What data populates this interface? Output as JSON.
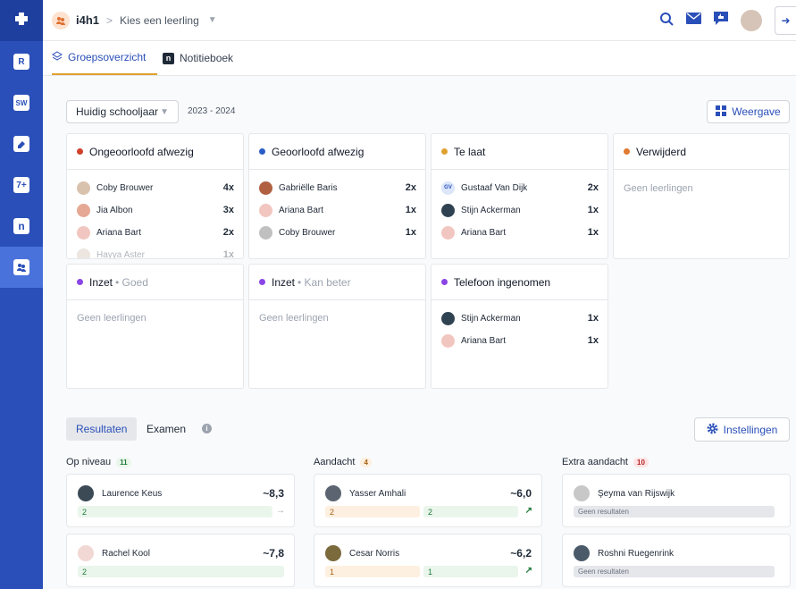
{
  "topbar": {
    "group_name": "i4h1",
    "separator": ">",
    "student_picker": "Kies een leerling"
  },
  "sidebar": {
    "items": [
      {
        "label": "R"
      },
      {
        "label": "SW"
      },
      {
        "label": ""
      },
      {
        "label": "7+"
      },
      {
        "label": "n"
      },
      {
        "label": ""
      }
    ]
  },
  "tabs": [
    {
      "label": "Groepsoverzicht",
      "active": true
    },
    {
      "label": "Notitieboek",
      "active": false
    }
  ],
  "toolbar": {
    "year_select": "Huidig schooljaar",
    "year_range": "2023 - 2024",
    "view_button": "Weergave"
  },
  "cards": [
    {
      "title": "Ongeoorloofd afwezig",
      "subtitle": "",
      "color": "#d0402a",
      "rows": [
        {
          "name": "Coby Brouwer",
          "count": "4x"
        },
        {
          "name": "Jia Albon",
          "count": "3x"
        },
        {
          "name": "Ariana Bart",
          "count": "2x"
        },
        {
          "name": "Hayya Aster",
          "count": "1x"
        }
      ]
    },
    {
      "title": "Geoorloofd afwezig",
      "subtitle": "",
      "color": "#2a5cc8",
      "rows": [
        {
          "name": "Gabriëlle Baris",
          "count": "2x"
        },
        {
          "name": "Ariana Bart",
          "count": "1x"
        },
        {
          "name": "Coby Brouwer",
          "count": "1x"
        }
      ]
    },
    {
      "title": "Te laat",
      "subtitle": "",
      "color": "#e0a030",
      "rows": [
        {
          "name": "Gustaaf Van Dijk",
          "count": "2x",
          "initials": "GV"
        },
        {
          "name": "Stijn Ackerman",
          "count": "1x"
        },
        {
          "name": "Ariana Bart",
          "count": "1x"
        }
      ]
    },
    {
      "title": "Verwijderd",
      "subtitle": "",
      "color": "#e07a30",
      "empty": "Geen leerlingen"
    },
    {
      "title": "Inzet",
      "subtitle": "• Goed",
      "color": "#8b45e6",
      "empty": "Geen leerlingen"
    },
    {
      "title": "Inzet",
      "subtitle": "• Kan beter",
      "color": "#8b45e6",
      "empty": "Geen leerlingen"
    },
    {
      "title": "Telefoon ingenomen",
      "subtitle": "",
      "color": "#8b45e6",
      "rows": [
        {
          "name": "Stijn Ackerman",
          "count": "1x"
        },
        {
          "name": "Ariana Bart",
          "count": "1x"
        }
      ]
    }
  ],
  "results": {
    "tabs": [
      "Resultaten",
      "Examen"
    ],
    "settings_button": "Instellingen",
    "columns": [
      {
        "title": "Op niveau",
        "count": "11",
        "students": [
          {
            "name": "Laurence Keus",
            "score": "~8,3",
            "bars": [
              "2"
            ],
            "trend": "→"
          },
          {
            "name": "Rachel Kool",
            "score": "~7,8",
            "bars": [
              "2"
            ],
            "trend": ""
          }
        ]
      },
      {
        "title": "Aandacht",
        "count": "4",
        "students": [
          {
            "name": "Yasser Amhali",
            "score": "~6,0",
            "bars": [
              "2",
              "2"
            ],
            "trend": "↗"
          },
          {
            "name": "Cesar Norris",
            "score": "~6,2",
            "bars": [
              "1",
              "1"
            ],
            "trend": "↗"
          }
        ]
      },
      {
        "title": "Extra aandacht",
        "count": "10",
        "students": [
          {
            "name": "Şeyma van Rijswijk",
            "score": "",
            "bars": [
              "Geen resultaten"
            ],
            "trend": ""
          },
          {
            "name": "Roshni Ruegenrink",
            "score": "",
            "bars": [
              "Geen resultaten"
            ],
            "trend": ""
          }
        ]
      }
    ]
  }
}
